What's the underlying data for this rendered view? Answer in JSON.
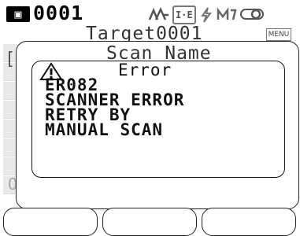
{
  "status_bar": {
    "left_icon": "card-icon",
    "left_icon_text": "▣",
    "id": "0001",
    "icons": [
      "mountain-icon",
      "ie-icon",
      "lightning-icon",
      "mask-icon",
      "toggle-icon"
    ],
    "icon_glyphs": {
      "mountain": "∩∩",
      "ie": "I-E",
      "lightning": "ϟ",
      "mask": "M̲",
      "toggle": "◎"
    }
  },
  "header": {
    "title": "Target0001",
    "menu_label": "MENU"
  },
  "background": {
    "bracket": "[",
    "partial_text": "O"
  },
  "dialog": {
    "context_label": "Scan Name",
    "title": "Error",
    "code": "ER082",
    "lines": [
      "SCANNER ERROR",
      "RETRY BY",
      "MANUAL SCAN"
    ],
    "icon": "warning-icon"
  },
  "soft_keys": [
    "",
    "",
    ""
  ],
  "colors": {
    "text": "#000000",
    "dim": "#999999",
    "background": "#ffffff"
  }
}
